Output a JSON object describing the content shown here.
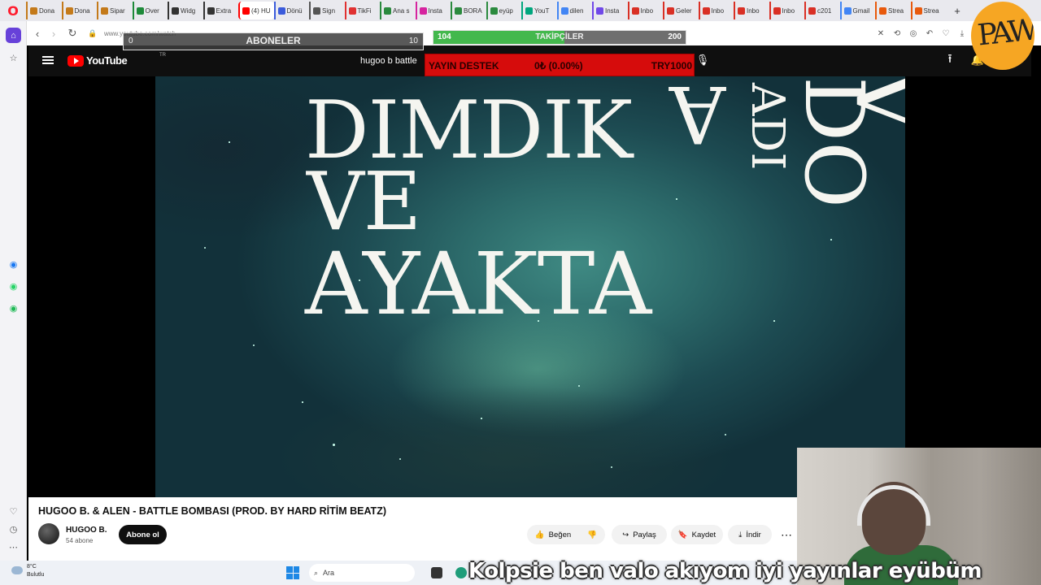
{
  "browser": {
    "logo": "O",
    "tabs": [
      {
        "label": "Dona",
        "color": "#c47a1a",
        "icon": "donation-favicon-icon"
      },
      {
        "label": "Dona",
        "color": "#c47a1a",
        "icon": "donation-favicon-icon"
      },
      {
        "label": "Sipar",
        "color": "#c47a1a",
        "icon": "order-favicon-icon"
      },
      {
        "label": "Over",
        "color": "#1e8a3a",
        "icon": "overlay-favicon-icon"
      },
      {
        "label": "Widg",
        "color": "#333333",
        "icon": "widget-favicon-icon"
      },
      {
        "label": "Extra",
        "color": "#333333",
        "icon": "clock-favicon-icon"
      },
      {
        "label": "(4) HU",
        "color": "#ff0000",
        "icon": "youtube-favicon-icon"
      },
      {
        "label": "Dönü",
        "color": "#3b5bdb",
        "icon": "app-favicon-icon"
      },
      {
        "label": "Sign",
        "color": "#555555",
        "icon": "page-favicon-icon"
      },
      {
        "label": "TikFi",
        "color": "#e03131",
        "icon": "tikfinity-favicon-icon"
      },
      {
        "label": "Ana s",
        "color": "#2b8a3e",
        "icon": "drive-favicon-icon"
      },
      {
        "label": "Insta",
        "color": "#d6249f",
        "icon": "instagram-favicon-icon"
      },
      {
        "label": "BORA",
        "color": "#2b8a3e",
        "icon": "drive-favicon-icon"
      },
      {
        "label": "eyüp",
        "color": "#2b8a3e",
        "icon": "drive-favicon-icon"
      },
      {
        "label": "YouT",
        "color": "#00a67d",
        "icon": "youtube-studio-favicon-icon"
      },
      {
        "label": "dilen",
        "color": "#4285f4",
        "icon": "google-favicon-icon"
      },
      {
        "label": "Insta",
        "color": "#7048e8",
        "icon": "app-favicon-icon"
      },
      {
        "label": "Inbo",
        "color": "#d93025",
        "icon": "gmail-favicon-icon"
      },
      {
        "label": "Geler",
        "color": "#d93025",
        "icon": "gmail-favicon-icon"
      },
      {
        "label": "Inbo",
        "color": "#d93025",
        "icon": "gmail-favicon-icon"
      },
      {
        "label": "Inbo",
        "color": "#d93025",
        "icon": "gmail-favicon-icon"
      },
      {
        "label": "Inbo",
        "color": "#d93025",
        "icon": "gmail-favicon-icon"
      },
      {
        "label": "c201",
        "color": "#d93025",
        "icon": "gmail-favicon-icon"
      },
      {
        "label": "Gmail",
        "color": "#4285f4",
        "icon": "google-favicon-icon"
      },
      {
        "label": "Strea",
        "color": "#e8590c",
        "icon": "stream-favicon-icon"
      },
      {
        "label": "Strea",
        "color": "#e8590c",
        "icon": "stream-favicon-icon"
      }
    ],
    "new_tab": "+",
    "url": "www.youtube.com/watch"
  },
  "youtube": {
    "logo_text": "YouTube",
    "country": "TR",
    "search_value": "hugoo b battle",
    "video_lyrics": {
      "line1": "DIMDIK",
      "line2": "VE",
      "line3": "AYAKTA",
      "rot_a": "A",
      "rot_adi": "ADI",
      "rot_do": "DO",
      "rot_v": "V"
    },
    "title": "HUGOO B. & ALEN - BATTLE BOMBASI (PROD. BY HARD RİTİM BEATZ)",
    "channel_name": "HUGOO B.",
    "channel_subs": "54 abone",
    "subscribe_label": "Abone ol",
    "actions": {
      "like": "Beğen",
      "share": "Paylaş",
      "save": "Kaydet",
      "download": "İndir",
      "more": "⋯"
    }
  },
  "overlays": {
    "subscribers": {
      "label": "ABONELER",
      "min": "0",
      "max": "10",
      "progress": 0
    },
    "followers": {
      "label": "TAKİPÇİLER",
      "min": "104",
      "max": "200",
      "progress": 0.52
    },
    "donation": {
      "label": "YAYIN DESTEK",
      "amount": "0₺ (0.00%)",
      "goal": "TRY1000"
    },
    "logo_text": "PAW",
    "ticker": "Kolpsie ben valo akıyom iyi yayınlar eyübüm"
  },
  "taskbar": {
    "temp": "8°C",
    "condition": "Bulutlu",
    "search_placeholder": "Ara"
  },
  "colors": {
    "yt_red": "#ff0000",
    "donation_red": "#d60c0c",
    "follower_green": "#43b84d",
    "paw_orange": "#f6a623"
  }
}
